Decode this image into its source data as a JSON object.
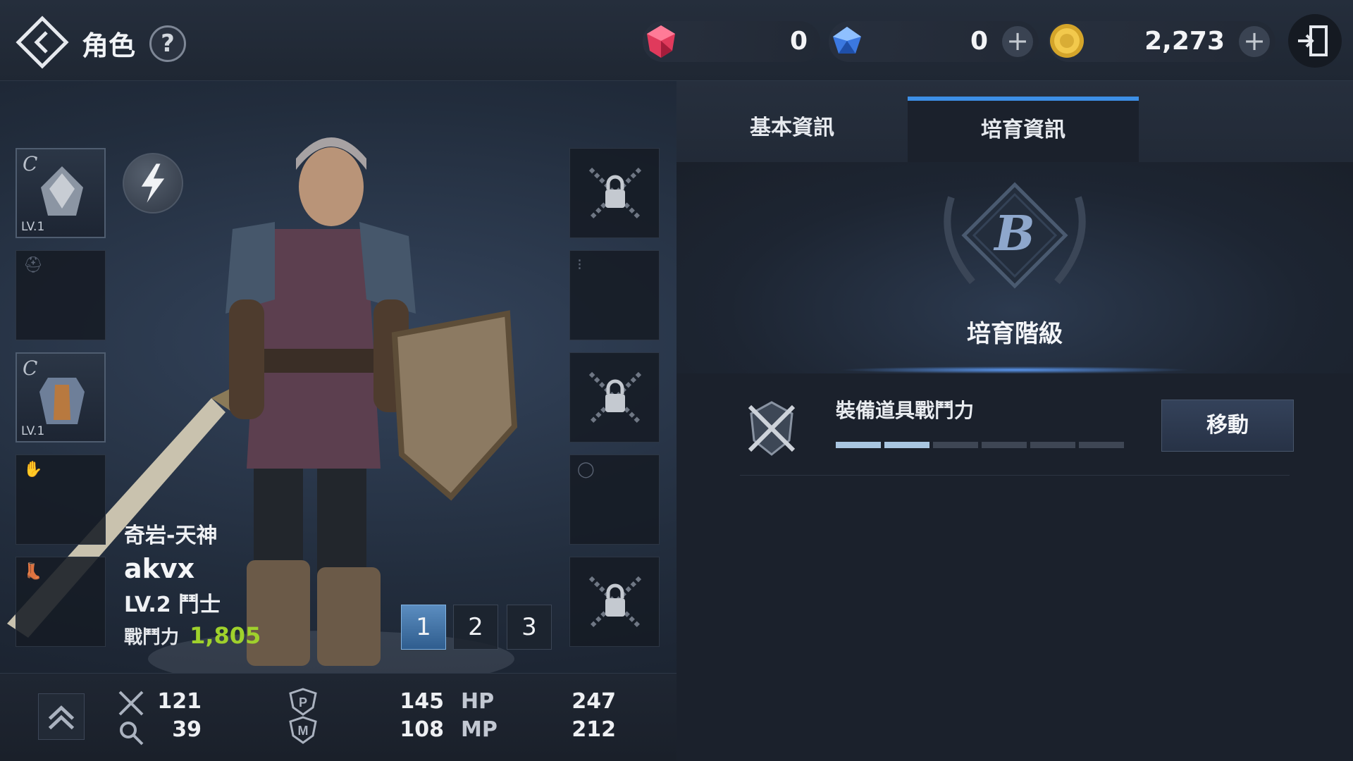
{
  "header": {
    "title": "角色",
    "help_label": "?",
    "currencies": [
      {
        "name": "red-gem",
        "amount": "0",
        "has_plus": false
      },
      {
        "name": "blue-gem",
        "amount": "0",
        "has_plus": true
      },
      {
        "name": "gold-coin",
        "amount": "2,273",
        "has_plus": true
      }
    ],
    "plus_label": "+"
  },
  "equipment": {
    "left_slots": [
      {
        "grade": "C",
        "level": "LV.1",
        "filled": true
      },
      {
        "grade": "",
        "level": "",
        "filled": false
      },
      {
        "grade": "C",
        "level": "LV.1",
        "filled": true
      },
      {
        "grade": "",
        "level": "",
        "filled": false
      },
      {
        "grade": "",
        "level": "",
        "filled": false
      }
    ],
    "right_slots": [
      {
        "locked": true
      },
      {
        "locked": false
      },
      {
        "locked": true
      },
      {
        "locked": false
      },
      {
        "locked": true
      }
    ]
  },
  "character": {
    "server": "奇岩-天神",
    "name": "akvx",
    "level_class": "LV.2  鬥士",
    "power_label": "戰鬥力",
    "power_value": "1,805"
  },
  "presets": {
    "items": [
      "1",
      "2",
      "3"
    ],
    "active": "1"
  },
  "stats": {
    "attack": "121",
    "accuracy": "39",
    "physical_def": "145",
    "magic_def": "108",
    "hp_label": "HP",
    "hp": "247",
    "mp_label": "MP",
    "mp": "212"
  },
  "tabs": [
    {
      "label": "基本資訊",
      "active": false
    },
    {
      "label": "培育資訊",
      "active": true
    }
  ],
  "growth": {
    "grade_letter": "B",
    "grade_label": "培育階級",
    "equip_power_label": "裝備道具戰鬥力",
    "progress_filled": 2,
    "progress_total": 6,
    "move_button": "移動"
  },
  "colors": {
    "accent_blue": "#3d8fe6",
    "power_green": "#9fd12c"
  }
}
